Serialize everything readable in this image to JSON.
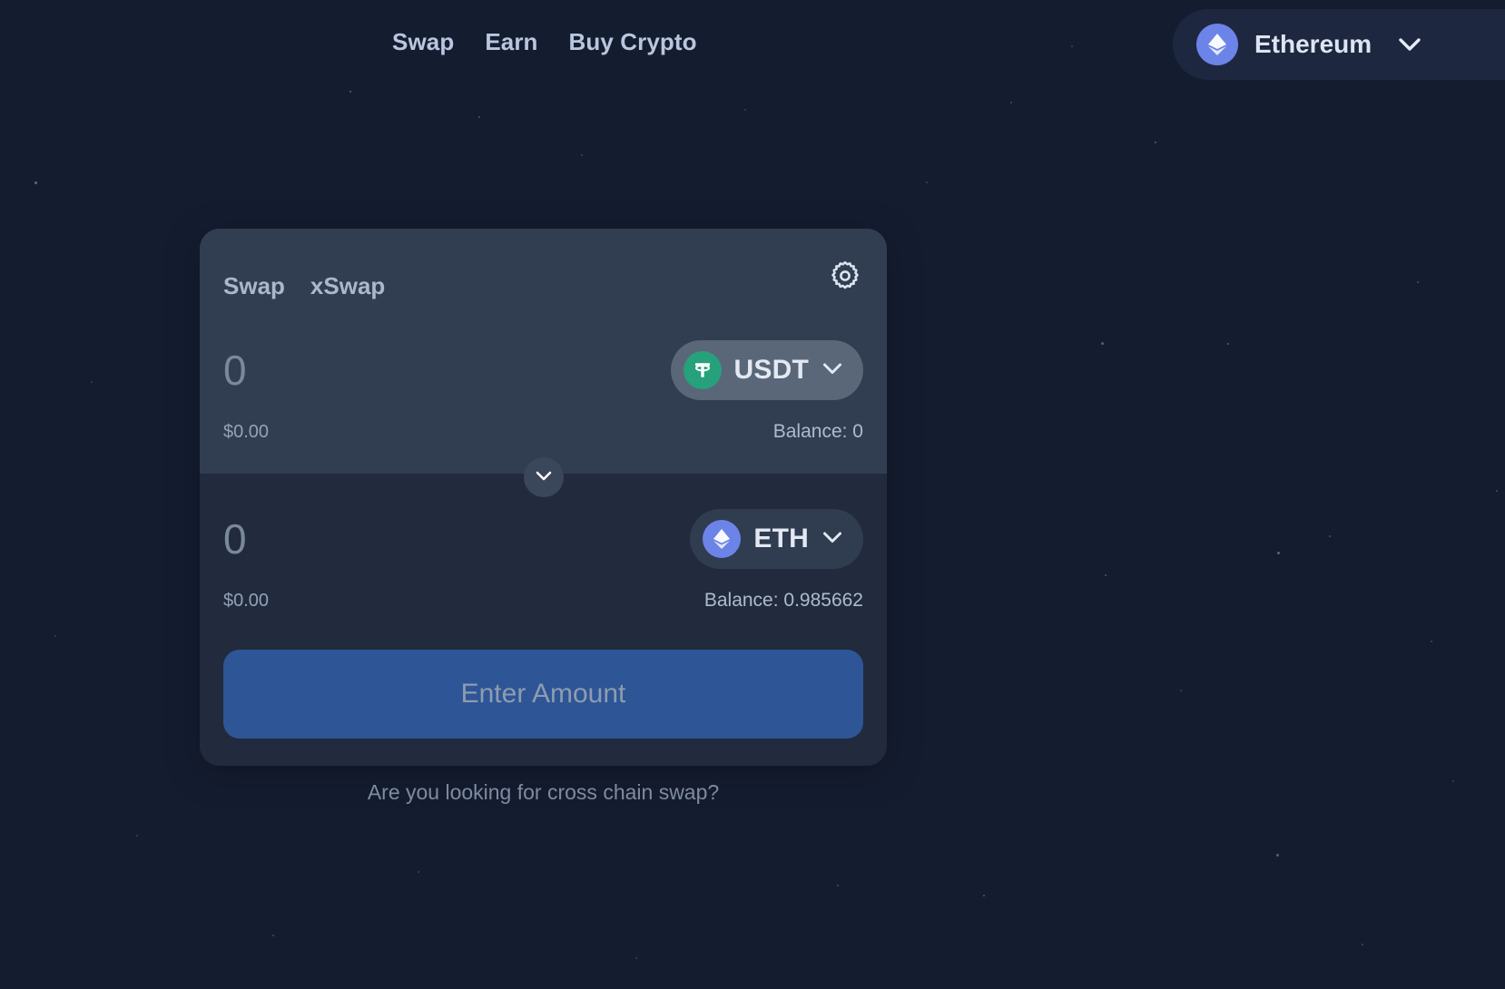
{
  "theme": {
    "background": "#141d30",
    "card_top": "#313d50",
    "card_bottom": "#212b3d",
    "accent_blue": "#2e5596",
    "usdt_green": "#26a17b",
    "eth_blue": "#6c84e8",
    "text_muted": "#7b879c"
  },
  "nav": {
    "items": [
      {
        "label": "Swap"
      },
      {
        "label": "Earn"
      },
      {
        "label": "Buy Crypto"
      }
    ]
  },
  "chain_selector": {
    "name": "Ethereum",
    "icon": "ethereum-icon",
    "chevron": "chevron-down-icon"
  },
  "card": {
    "tabs": [
      {
        "label": "Swap",
        "active": true
      },
      {
        "label": "xSwap",
        "active": false
      }
    ],
    "settings_icon": "gear-icon",
    "swap_direction_icon": "chevron-down-icon",
    "from": {
      "amount": "0",
      "placeholder": "0",
      "token": "USDT",
      "token_icon": "tether-icon",
      "usd_value": "$0.00",
      "balance": "Balance: 0"
    },
    "to": {
      "amount": "0",
      "placeholder": "0",
      "token": "ETH",
      "token_icon": "ethereum-icon",
      "usd_value": "$0.00",
      "balance": "Balance: 0.985662"
    },
    "cta_label": "Enter Amount"
  },
  "footer": {
    "cross_chain_prompt": "Are you looking for cross chain swap?"
  }
}
